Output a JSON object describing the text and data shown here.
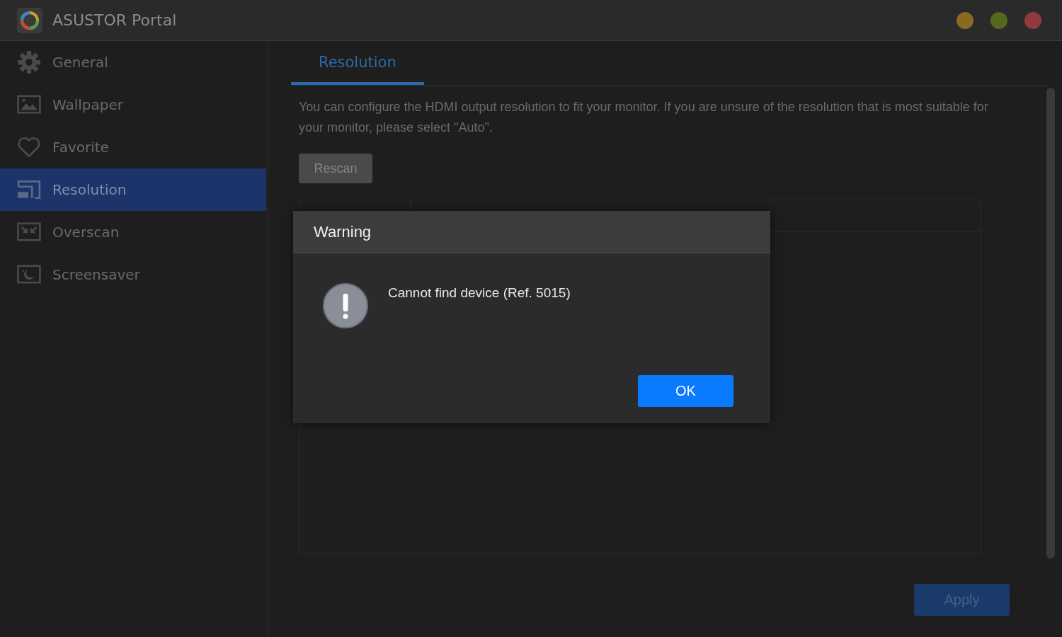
{
  "window": {
    "title": "ASUSTOR Portal",
    "controls": [
      {
        "color": "#8a6a22"
      },
      {
        "color": "#55691e"
      },
      {
        "color": "#8f3b3e"
      }
    ]
  },
  "sidebar": {
    "items": [
      {
        "kind": "gear",
        "label": "General",
        "selected": false
      },
      {
        "kind": "picture",
        "label": "Wallpaper",
        "selected": false
      },
      {
        "kind": "heart",
        "label": "Favorite",
        "selected": false
      },
      {
        "kind": "resolution",
        "label": "Resolution",
        "selected": true
      },
      {
        "kind": "overscan",
        "label": "Overscan",
        "selected": false
      },
      {
        "kind": "moon",
        "label": "Screensaver",
        "selected": false
      }
    ]
  },
  "tabs": [
    {
      "label": "Resolution",
      "selected": true
    }
  ],
  "description": "You can configure the HDMI output resolution to fit your monitor. If you are unsure of the resolution that is most suitable for your monitor, please select \"Auto\".",
  "rescan_button": "Rescan",
  "apply_button": "Apply",
  "dialog": {
    "title": "Warning",
    "message": "Cannot find device (Ref. 5015)",
    "ok_button": "OK"
  }
}
